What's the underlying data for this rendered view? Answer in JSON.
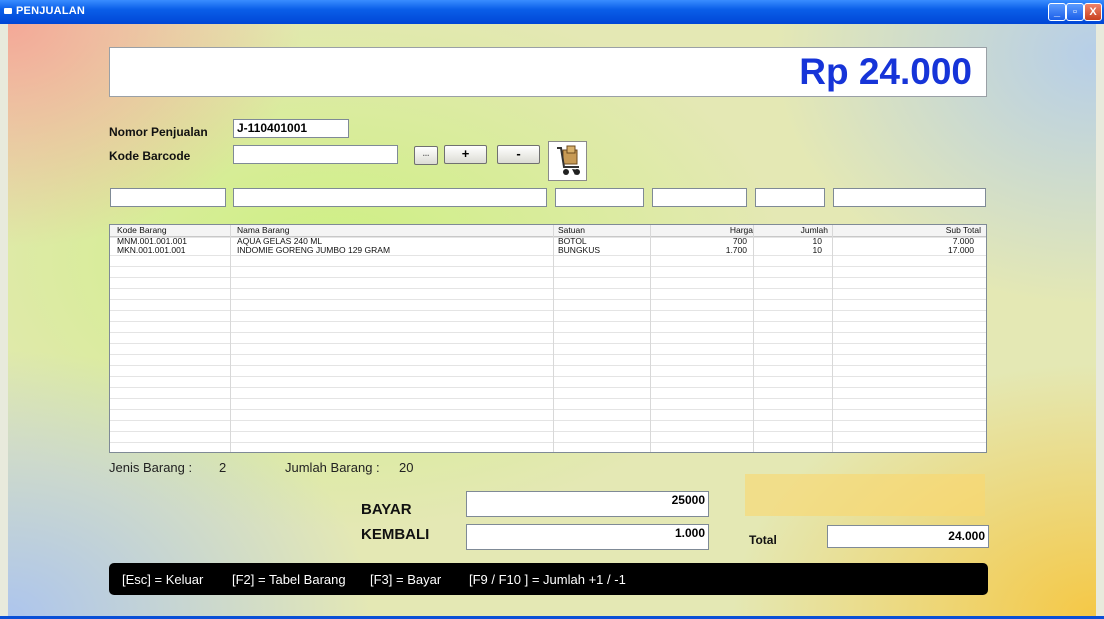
{
  "window": {
    "title": "PENJUALAN",
    "minimize": "_",
    "maximize": "▫",
    "close": "X"
  },
  "total_display": "Rp 24.000",
  "form": {
    "nomor_label": "Nomor Penjualan",
    "nomor_value": "J-110401001",
    "barcode_label": "Kode Barcode",
    "barcode_value": "",
    "browse_label": "...",
    "plus_label": "+",
    "minus_label": "-"
  },
  "table": {
    "columns": [
      "Kode Barang",
      "Nama Barang",
      "Satuan",
      "Harga",
      "Jumlah",
      "Sub Total"
    ],
    "rows": [
      [
        "MNM.001.001.001",
        "AQUA GELAS 240 ML",
        "BOTOL",
        "700",
        "10",
        "7.000"
      ],
      [
        "MKN.001.001.001",
        "INDOMIE GORENG JUMBO 129 GRAM",
        "BUNGKUS",
        "1.700",
        "10",
        "17.000"
      ]
    ]
  },
  "stats": {
    "jenis_label": "Jenis Barang :",
    "jenis_value": "2",
    "jumlah_label": "Jumlah Barang :",
    "jumlah_value": "20"
  },
  "payment": {
    "bayar_label": "BAYAR",
    "bayar_value": "25000",
    "kembali_label": "KEMBALI",
    "kembali_value": "1.000",
    "total_label": "Total",
    "total_value": "24.000"
  },
  "footer": {
    "esc": "[Esc] = Keluar",
    "f2": "[F2] = Tabel Barang",
    "f3": "[F3] = Bayar",
    "f9": "[F9 / F10 ] = Jumlah +1 / -1"
  },
  "colors": {
    "total_text": "#1634d8",
    "titlebar": "#0a5ee8",
    "footer_bg": "#000000"
  },
  "icons": [
    "app-icon",
    "shopping-cart-icon"
  ]
}
